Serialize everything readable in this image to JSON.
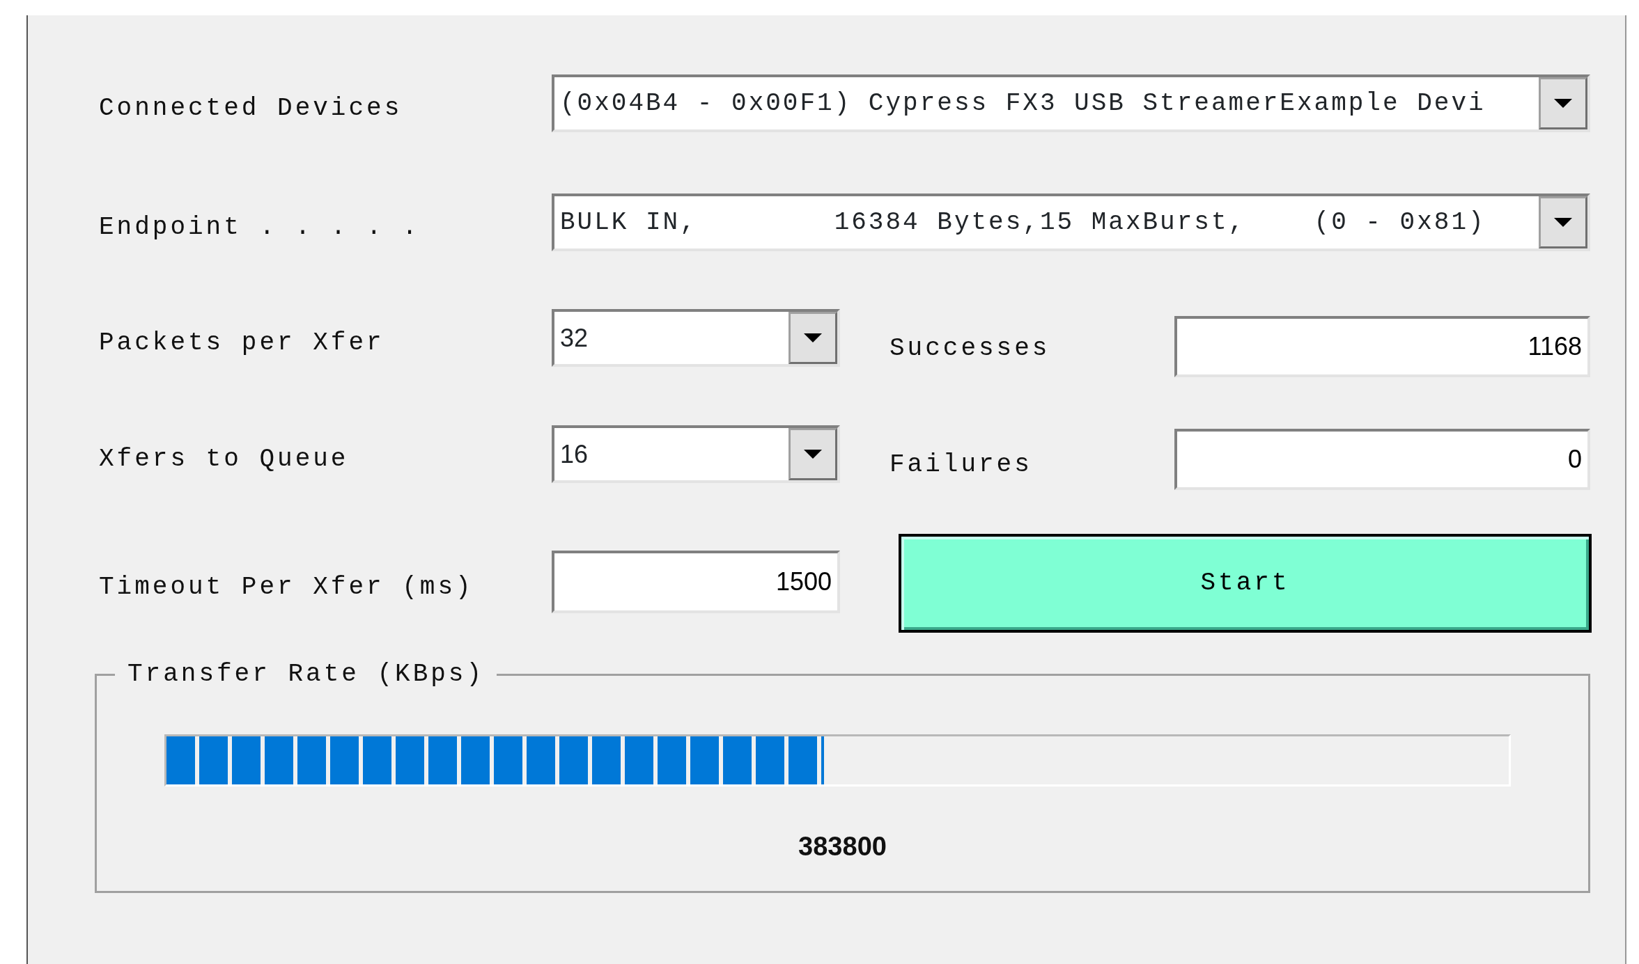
{
  "connected_devices": {
    "label": "Connected Devices",
    "value": "(0x04B4 - 0x00F1) Cypress FX3 USB StreamerExample Devi"
  },
  "endpoint": {
    "label": "Endpoint . . . . .",
    "value": "BULK IN,        16384 Bytes,15 MaxBurst,    (0 - 0x81)"
  },
  "packets_per_xfer": {
    "label": "Packets per Xfer",
    "value": "32"
  },
  "xfers_to_queue": {
    "label": "Xfers to Queue",
    "value": "16"
  },
  "timeout": {
    "label": "Timeout Per Xfer (ms)",
    "value": "1500"
  },
  "successes": {
    "label": "Successes",
    "value": "1168"
  },
  "failures": {
    "label": "Failures",
    "value": "0"
  },
  "start_button": {
    "label": "Start"
  },
  "transfer_rate": {
    "title": "Transfer Rate (KBps)",
    "level": 0.49,
    "reading": "383800"
  }
}
